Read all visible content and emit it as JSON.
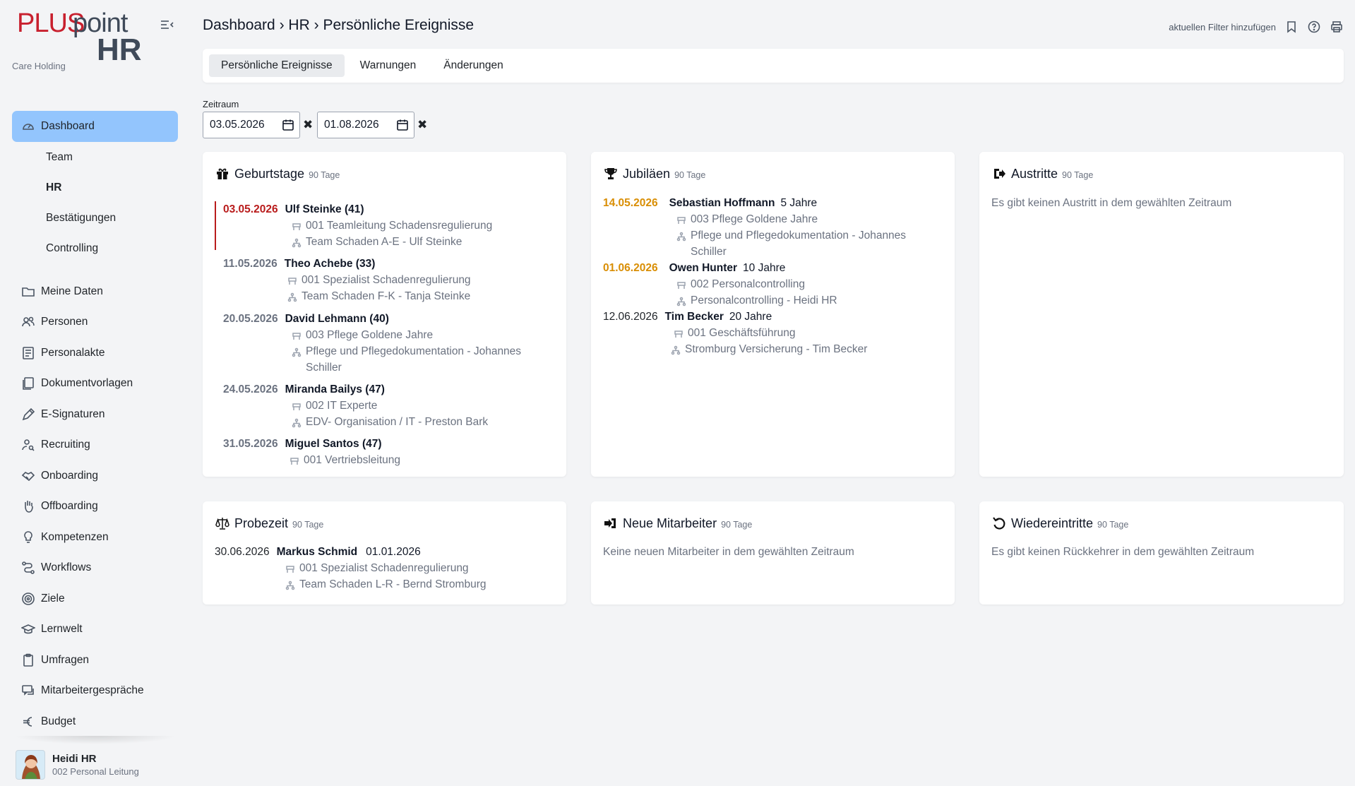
{
  "brand": {
    "plus": "PLUS",
    "point": "point",
    "hr": "HR",
    "company": "Care Holding"
  },
  "nav": {
    "dashboard": "Dashboard",
    "sub": [
      "Team",
      "HR",
      "Bestätigungen",
      "Controlling"
    ],
    "items": [
      {
        "label": "Meine Daten",
        "icon": "folder-icon"
      },
      {
        "label": "Personen",
        "icon": "users-icon"
      },
      {
        "label": "Personalakte",
        "icon": "file-list-icon"
      },
      {
        "label": "Dokumentvorlagen",
        "icon": "documents-icon"
      },
      {
        "label": "E-Signaturen",
        "icon": "pen-icon"
      },
      {
        "label": "Recruiting",
        "icon": "user-search-icon"
      },
      {
        "label": "Onboarding",
        "icon": "handshake-icon"
      },
      {
        "label": "Offboarding",
        "icon": "hand-icon"
      },
      {
        "label": "Kompetenzen",
        "icon": "lightbulb-icon"
      },
      {
        "label": "Workflows",
        "icon": "workflow-icon"
      },
      {
        "label": "Ziele",
        "icon": "target-icon"
      },
      {
        "label": "Lernwelt",
        "icon": "graduation-cap-icon"
      },
      {
        "label": "Umfragen",
        "icon": "clipboard-icon"
      },
      {
        "label": "Mitarbeitergespräche",
        "icon": "chat-icon"
      },
      {
        "label": "Budget",
        "icon": "euro-icon"
      }
    ]
  },
  "profile": {
    "name": "Heidi HR",
    "role": "002 Personal Leitung"
  },
  "header": {
    "crumb1": "Dashboard",
    "sep": "›",
    "crumb2": "HR",
    "crumb3": "Persönliche Ereignisse",
    "filter_link": "aktuellen Filter hinzufügen"
  },
  "tabs": [
    "Persönliche Ereignisse",
    "Warnungen",
    "Änderungen"
  ],
  "zeitraum": {
    "label": "Zeitraum",
    "from": "03.05.2026",
    "to": "01.08.2026",
    "clear": "✖"
  },
  "cards": {
    "geburtstage": {
      "title": "Geburtstage",
      "sub": "90 Tage",
      "events": [
        {
          "date": "03.05.2026",
          "name": "Ulf Steinke (41)",
          "pos": "001 Teamleitung Schadensregulierung",
          "org": "Team Schaden A-E - Ulf Steinke"
        },
        {
          "date": "11.05.2026",
          "name": "Theo Achebe (33)",
          "pos": "001 Spezialist Schadenregulierung",
          "org": "Team Schaden F-K - Tanja Steinke"
        },
        {
          "date": "20.05.2026",
          "name": "David Lehmann (40)",
          "pos": "003 Pflege Goldene Jahre",
          "org": "Pflege und Pflegedokumentation - Johannes Schiller"
        },
        {
          "date": "24.05.2026",
          "name": "Miranda Bailys (47)",
          "pos": "002 IT Experte",
          "org": "EDV- Organisation / IT - Preston Bark"
        },
        {
          "date": "31.05.2026",
          "name": "Miguel Santos (47)",
          "pos": "001 Vertriebsleitung",
          "org": ""
        }
      ]
    },
    "jubilaeen": {
      "title": "Jubiläen",
      "sub": "90 Tage",
      "events": [
        {
          "date": "14.05.2026",
          "name": "Sebastian Hoffmann",
          "extra": "5 Jahre",
          "pos": "003 Pflege Goldene Jahre",
          "org": "Pflege und Pflegedokumentation - Johannes Schiller"
        },
        {
          "date": "01.06.2026",
          "name": "Owen Hunter",
          "extra": "10 Jahre",
          "pos": "002 Personalcontrolling",
          "org": "Personalcontrolling - Heidi HR"
        },
        {
          "date": "12.06.2026",
          "name": "Tim Becker",
          "extra": "20 Jahre",
          "pos": "001 Geschäftsführung",
          "org": "Stromburg Versicherung - Tim Becker"
        }
      ]
    },
    "austritte": {
      "title": "Austritte",
      "sub": "90 Tage",
      "empty": "Es gibt keinen Austritt in dem gewählten Zeitraum"
    },
    "probezeit": {
      "title": "Probezeit",
      "sub": "90 Tage",
      "events": [
        {
          "date": "30.06.2026",
          "name": "Markus Schmid",
          "extra": "01.01.2026",
          "pos": "001 Spezialist Schadenregulierung",
          "org": "Team Schaden L-R - Bernd Stromburg"
        }
      ]
    },
    "neue": {
      "title": "Neue Mitarbeiter",
      "sub": "90 Tage",
      "empty": "Keine neuen Mitarbeiter in dem gewählten Zeitraum"
    },
    "wieder": {
      "title": "Wiedereintritte",
      "sub": "90 Tage",
      "empty": "Es gibt keinen Rückkehrer in dem gewählten Zeitraum"
    }
  },
  "colors": {
    "accent": "#93c5fd",
    "brand_red": "#c8202e",
    "highlight_red": "#b91c1c",
    "jubilee_gold": "#d98e04"
  }
}
